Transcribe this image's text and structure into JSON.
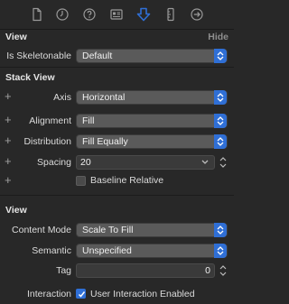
{
  "toolbar": {
    "icons": [
      "file-inspector-icon",
      "history-icon",
      "help-icon",
      "identity-icon",
      "attributes-inspector-icon",
      "size-inspector-icon",
      "connections-inspector-icon"
    ],
    "selected": "attributes-inspector-icon",
    "accent": "#2f6fd6"
  },
  "view_section": {
    "title": "View",
    "hide_label": "Hide",
    "is_skeletonable": {
      "label": "Is Skeletonable",
      "value": "Default"
    }
  },
  "stack_view": {
    "title": "Stack View",
    "axis": {
      "label": "Axis",
      "value": "Horizontal"
    },
    "alignment": {
      "label": "Alignment",
      "value": "Fill"
    },
    "distribution": {
      "label": "Distribution",
      "value": "Fill Equally"
    },
    "spacing": {
      "label": "Spacing",
      "value": "20"
    },
    "baseline_relative": {
      "label": "Baseline Relative",
      "checked": false
    }
  },
  "view_props": {
    "title": "View",
    "content_mode": {
      "label": "Content Mode",
      "value": "Scale To Fill"
    },
    "semantic": {
      "label": "Semantic",
      "value": "Unspecified"
    },
    "tag": {
      "label": "Tag",
      "value": "0"
    },
    "interaction": {
      "label": "Interaction",
      "checkbox_label": "User Interaction Enabled",
      "checked": true
    }
  }
}
